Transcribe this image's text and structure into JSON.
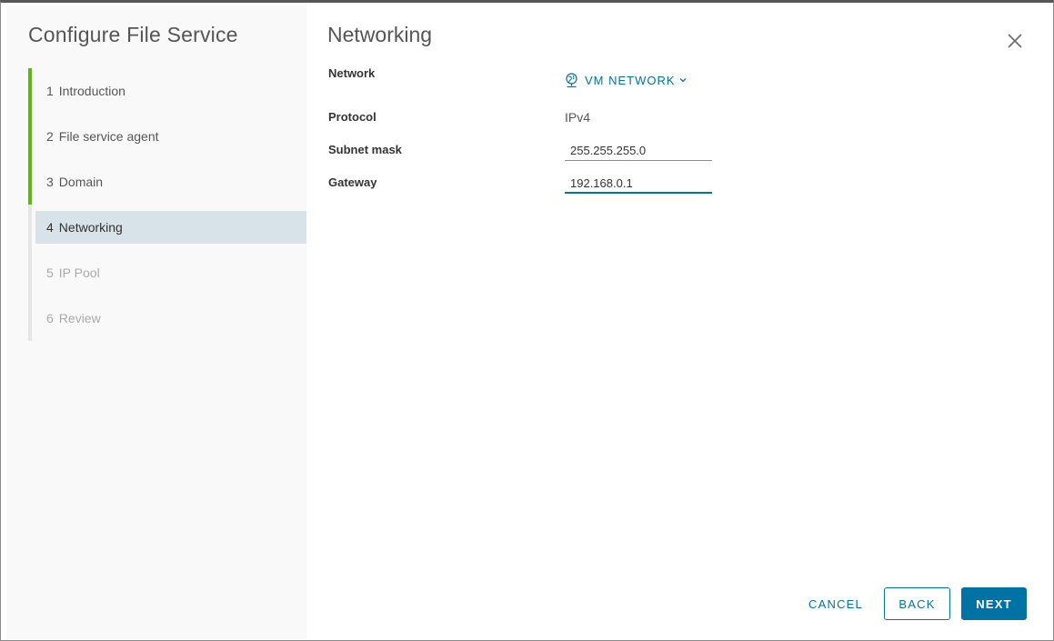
{
  "wizard": {
    "title": "Configure File Service",
    "steps": [
      {
        "number": "1",
        "label": "Introduction",
        "state": "complete"
      },
      {
        "number": "2",
        "label": "File service agent",
        "state": "complete"
      },
      {
        "number": "3",
        "label": "Domain",
        "state": "complete"
      },
      {
        "number": "4",
        "label": "Networking",
        "state": "active"
      },
      {
        "number": "5",
        "label": "IP Pool",
        "state": "disabled"
      },
      {
        "number": "6",
        "label": "Review",
        "state": "disabled"
      }
    ]
  },
  "page": {
    "title": "Networking",
    "close_icon": "close-icon"
  },
  "form": {
    "network": {
      "label": "Network",
      "value": "VM NETWORK",
      "icon": "network-icon"
    },
    "protocol": {
      "label": "Protocol",
      "value": "IPv4"
    },
    "subnet_mask": {
      "label": "Subnet mask",
      "value": "255.255.255.0"
    },
    "gateway": {
      "label": "Gateway",
      "value": "192.168.0.1"
    }
  },
  "footer": {
    "cancel_label": "CANCEL",
    "back_label": "BACK",
    "next_label": "NEXT"
  },
  "colors": {
    "accent": "#0072a3",
    "step_complete": "#5eb715",
    "step_active_bg": "#d8e3e9"
  }
}
